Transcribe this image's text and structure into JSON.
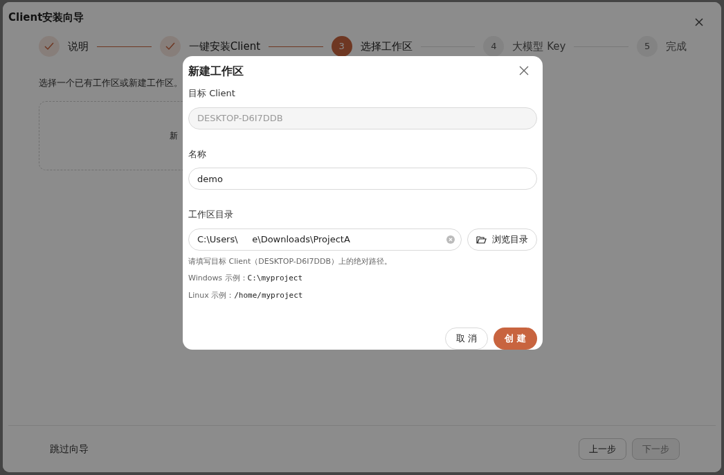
{
  "window": {
    "title": "Client安装向导"
  },
  "steps": [
    {
      "label": "说明",
      "done": true,
      "active": false
    },
    {
      "label": "一键安装Client",
      "done": true,
      "active": false
    },
    {
      "number": "3",
      "label": "选择工作区",
      "done": false,
      "active": true
    },
    {
      "number": "4",
      "label": "大模型 Key",
      "done": false,
      "active": false
    },
    {
      "number": "5",
      "label": "完成",
      "done": false,
      "active": false
    }
  ],
  "intro": "选择一个已有工作区或新建工作区。",
  "new_card": {
    "label": "新"
  },
  "footer": {
    "skip": "跳过向导",
    "prev": {
      "label": "上一步",
      "disabled": false
    },
    "next": {
      "label": "下一步",
      "disabled": true
    }
  },
  "dialog": {
    "title": "新建工作区",
    "fields": [
      {
        "kind": "text",
        "label": "目标 Client",
        "value": "DESKTOP-D6I7DDB",
        "disabled": true
      },
      {
        "kind": "text",
        "label": "名称",
        "value": "demo",
        "disabled": false
      },
      {
        "kind": "path",
        "label": "工作区目录",
        "value": "C:\\Users\\     e\\Downloads\\ProjectA",
        "disabled": false,
        "browse": "浏览目录",
        "help": [
          "请填写目标 Client（DESKTOP-D6I7DDB）上的绝对路径。"
        ],
        "examples": [
          {
            "label": "Windows 示例：",
            "code": "C:\\myproject"
          },
          {
            "label": "Linux 示例：",
            "code": "/home/myproject"
          }
        ]
      }
    ],
    "cancel": "取 消",
    "create": "创 建"
  }
}
